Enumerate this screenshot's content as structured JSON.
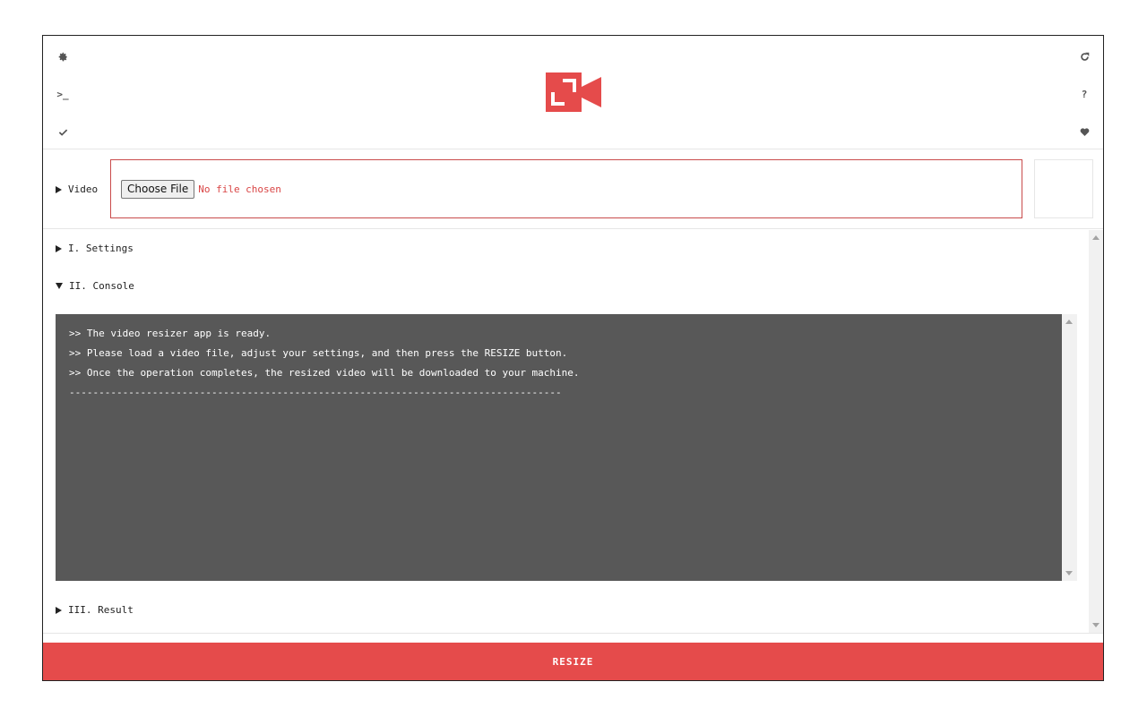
{
  "header": {
    "left_icons": [
      "gear-icon",
      "terminal-icon",
      "check-icon"
    ],
    "right_icons": [
      "refresh-icon",
      "question-icon",
      "heart-icon"
    ],
    "terminal_glyph": ">_",
    "question_glyph": "?",
    "logo_color": "#e54b4b"
  },
  "video": {
    "label": "Video",
    "choose_label": "Choose File",
    "status": "No file chosen"
  },
  "sections": {
    "settings": "I. Settings",
    "console": "II. Console",
    "result": "III. Result"
  },
  "console": {
    "lines": [
      ">> The video resizer app is ready.",
      ">> Please load a video file, adjust your settings, and then press the RESIZE button.",
      ">> Once the operation completes, the resized video will be downloaded to your machine.",
      "-----------------------------------------------------------------------------------"
    ]
  },
  "actions": {
    "resize_label": "RESIZE"
  },
  "colors": {
    "accent": "#e54b4b",
    "console_bg": "#585858"
  }
}
